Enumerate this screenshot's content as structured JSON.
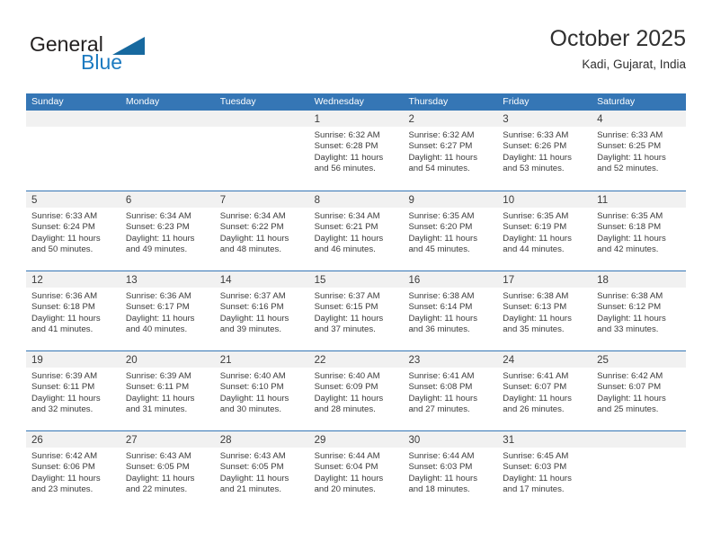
{
  "brand": {
    "word_one": "General",
    "word_two": "Blue",
    "triangle_icon": "triangle-icon",
    "accent_color": "#1c7ac0"
  },
  "header": {
    "title": "October 2025",
    "subtitle": "Kadi, Gujarat, India"
  },
  "calendar": {
    "header_bg": "#3576b5",
    "daynum_bg": "#f1f1f1",
    "weekday_headers": [
      "Sunday",
      "Monday",
      "Tuesday",
      "Wednesday",
      "Thursday",
      "Friday",
      "Saturday"
    ],
    "weeks": [
      [
        {
          "day": "",
          "lines": []
        },
        {
          "day": "",
          "lines": []
        },
        {
          "day": "",
          "lines": []
        },
        {
          "day": "1",
          "lines": [
            "Sunrise: 6:32 AM",
            "Sunset: 6:28 PM",
            "Daylight: 11 hours",
            "and 56 minutes."
          ]
        },
        {
          "day": "2",
          "lines": [
            "Sunrise: 6:32 AM",
            "Sunset: 6:27 PM",
            "Daylight: 11 hours",
            "and 54 minutes."
          ]
        },
        {
          "day": "3",
          "lines": [
            "Sunrise: 6:33 AM",
            "Sunset: 6:26 PM",
            "Daylight: 11 hours",
            "and 53 minutes."
          ]
        },
        {
          "day": "4",
          "lines": [
            "Sunrise: 6:33 AM",
            "Sunset: 6:25 PM",
            "Daylight: 11 hours",
            "and 52 minutes."
          ]
        }
      ],
      [
        {
          "day": "5",
          "lines": [
            "Sunrise: 6:33 AM",
            "Sunset: 6:24 PM",
            "Daylight: 11 hours",
            "and 50 minutes."
          ]
        },
        {
          "day": "6",
          "lines": [
            "Sunrise: 6:34 AM",
            "Sunset: 6:23 PM",
            "Daylight: 11 hours",
            "and 49 minutes."
          ]
        },
        {
          "day": "7",
          "lines": [
            "Sunrise: 6:34 AM",
            "Sunset: 6:22 PM",
            "Daylight: 11 hours",
            "and 48 minutes."
          ]
        },
        {
          "day": "8",
          "lines": [
            "Sunrise: 6:34 AM",
            "Sunset: 6:21 PM",
            "Daylight: 11 hours",
            "and 46 minutes."
          ]
        },
        {
          "day": "9",
          "lines": [
            "Sunrise: 6:35 AM",
            "Sunset: 6:20 PM",
            "Daylight: 11 hours",
            "and 45 minutes."
          ]
        },
        {
          "day": "10",
          "lines": [
            "Sunrise: 6:35 AM",
            "Sunset: 6:19 PM",
            "Daylight: 11 hours",
            "and 44 minutes."
          ]
        },
        {
          "day": "11",
          "lines": [
            "Sunrise: 6:35 AM",
            "Sunset: 6:18 PM",
            "Daylight: 11 hours",
            "and 42 minutes."
          ]
        }
      ],
      [
        {
          "day": "12",
          "lines": [
            "Sunrise: 6:36 AM",
            "Sunset: 6:18 PM",
            "Daylight: 11 hours",
            "and 41 minutes."
          ]
        },
        {
          "day": "13",
          "lines": [
            "Sunrise: 6:36 AM",
            "Sunset: 6:17 PM",
            "Daylight: 11 hours",
            "and 40 minutes."
          ]
        },
        {
          "day": "14",
          "lines": [
            "Sunrise: 6:37 AM",
            "Sunset: 6:16 PM",
            "Daylight: 11 hours",
            "and 39 minutes."
          ]
        },
        {
          "day": "15",
          "lines": [
            "Sunrise: 6:37 AM",
            "Sunset: 6:15 PM",
            "Daylight: 11 hours",
            "and 37 minutes."
          ]
        },
        {
          "day": "16",
          "lines": [
            "Sunrise: 6:38 AM",
            "Sunset: 6:14 PM",
            "Daylight: 11 hours",
            "and 36 minutes."
          ]
        },
        {
          "day": "17",
          "lines": [
            "Sunrise: 6:38 AM",
            "Sunset: 6:13 PM",
            "Daylight: 11 hours",
            "and 35 minutes."
          ]
        },
        {
          "day": "18",
          "lines": [
            "Sunrise: 6:38 AM",
            "Sunset: 6:12 PM",
            "Daylight: 11 hours",
            "and 33 minutes."
          ]
        }
      ],
      [
        {
          "day": "19",
          "lines": [
            "Sunrise: 6:39 AM",
            "Sunset: 6:11 PM",
            "Daylight: 11 hours",
            "and 32 minutes."
          ]
        },
        {
          "day": "20",
          "lines": [
            "Sunrise: 6:39 AM",
            "Sunset: 6:11 PM",
            "Daylight: 11 hours",
            "and 31 minutes."
          ]
        },
        {
          "day": "21",
          "lines": [
            "Sunrise: 6:40 AM",
            "Sunset: 6:10 PM",
            "Daylight: 11 hours",
            "and 30 minutes."
          ]
        },
        {
          "day": "22",
          "lines": [
            "Sunrise: 6:40 AM",
            "Sunset: 6:09 PM",
            "Daylight: 11 hours",
            "and 28 minutes."
          ]
        },
        {
          "day": "23",
          "lines": [
            "Sunrise: 6:41 AM",
            "Sunset: 6:08 PM",
            "Daylight: 11 hours",
            "and 27 minutes."
          ]
        },
        {
          "day": "24",
          "lines": [
            "Sunrise: 6:41 AM",
            "Sunset: 6:07 PM",
            "Daylight: 11 hours",
            "and 26 minutes."
          ]
        },
        {
          "day": "25",
          "lines": [
            "Sunrise: 6:42 AM",
            "Sunset: 6:07 PM",
            "Daylight: 11 hours",
            "and 25 minutes."
          ]
        }
      ],
      [
        {
          "day": "26",
          "lines": [
            "Sunrise: 6:42 AM",
            "Sunset: 6:06 PM",
            "Daylight: 11 hours",
            "and 23 minutes."
          ]
        },
        {
          "day": "27",
          "lines": [
            "Sunrise: 6:43 AM",
            "Sunset: 6:05 PM",
            "Daylight: 11 hours",
            "and 22 minutes."
          ]
        },
        {
          "day": "28",
          "lines": [
            "Sunrise: 6:43 AM",
            "Sunset: 6:05 PM",
            "Daylight: 11 hours",
            "and 21 minutes."
          ]
        },
        {
          "day": "29",
          "lines": [
            "Sunrise: 6:44 AM",
            "Sunset: 6:04 PM",
            "Daylight: 11 hours",
            "and 20 minutes."
          ]
        },
        {
          "day": "30",
          "lines": [
            "Sunrise: 6:44 AM",
            "Sunset: 6:03 PM",
            "Daylight: 11 hours",
            "and 18 minutes."
          ]
        },
        {
          "day": "31",
          "lines": [
            "Sunrise: 6:45 AM",
            "Sunset: 6:03 PM",
            "Daylight: 11 hours",
            "and 17 minutes."
          ]
        },
        {
          "day": "",
          "lines": []
        }
      ]
    ]
  }
}
